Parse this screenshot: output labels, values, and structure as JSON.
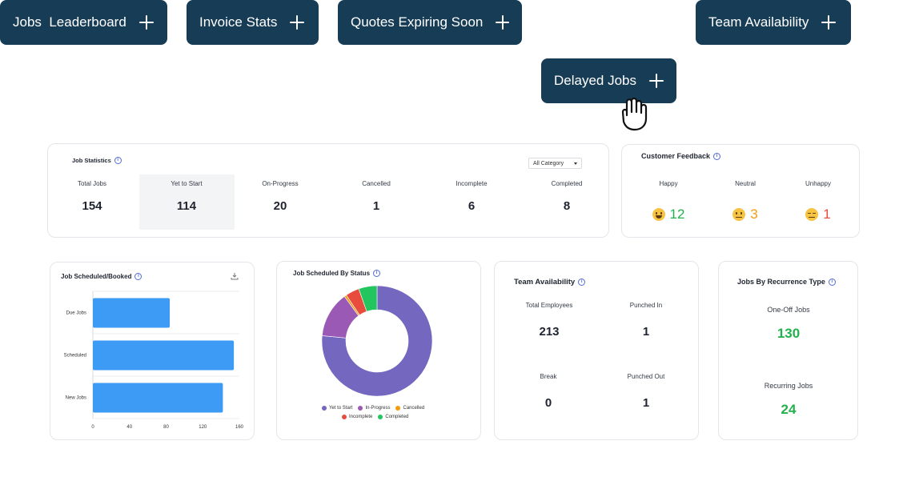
{
  "top_buttons": [
    {
      "label": "Jobs  Leaderboard"
    },
    {
      "label": "Invoice Stats"
    },
    {
      "label": "Quotes Expiring Soon"
    },
    {
      "label": "Team Availability"
    },
    {
      "label": "Delayed Jobs"
    }
  ],
  "job_statistics": {
    "title": "Job Statistics",
    "dropdown": "All Category",
    "items": [
      {
        "label": "Total Jobs",
        "value": "154"
      },
      {
        "label": "Yet to Start",
        "value": "114"
      },
      {
        "label": "On-Progress",
        "value": "20"
      },
      {
        "label": "Cancelled",
        "value": "1"
      },
      {
        "label": "Incomplete",
        "value": "6"
      },
      {
        "label": "Completed",
        "value": "8"
      }
    ]
  },
  "customer_feedback": {
    "title": "Customer Feedback",
    "items": [
      {
        "label": "Happy",
        "value": "12",
        "color": "#22b14c"
      },
      {
        "label": "Neutral",
        "value": "3",
        "color": "#f39c12"
      },
      {
        "label": "Unhappy",
        "value": "1",
        "color": "#e74c3c"
      }
    ]
  },
  "job_scheduled_booked": {
    "title": "Job Scheduled/Booked",
    "chart_data": {
      "type": "bar",
      "orientation": "horizontal",
      "categories": [
        "Due Jobs",
        "Scheduled",
        "New Jobs"
      ],
      "values": [
        84,
        154,
        142
      ],
      "xticks": [
        "0",
        "40",
        "80",
        "120",
        "160"
      ],
      "xlim": [
        0,
        160
      ],
      "color": "#3d9af5"
    }
  },
  "job_scheduled_by_status": {
    "title": "Job Scheduled By Status",
    "chart_data": {
      "type": "pie",
      "donut": true,
      "labels": [
        "Yet to Start",
        "In-Progress",
        "Cancelled",
        "Incomplete",
        "Completed"
      ],
      "values": [
        114,
        20,
        1,
        6,
        8
      ],
      "colors": [
        "#7367c0",
        "#9b59b6",
        "#f39c12",
        "#e74c3c",
        "#22c55e"
      ]
    }
  },
  "team_availability": {
    "title": "Team Availability",
    "items": [
      {
        "label": "Total Employees",
        "value": "213"
      },
      {
        "label": "Punched In",
        "value": "1"
      },
      {
        "label": "Break",
        "value": "0"
      },
      {
        "label": "Punched Out",
        "value": "1"
      }
    ]
  },
  "jobs_by_recurrence": {
    "title": "Jobs By Recurrence Type",
    "items": [
      {
        "label": "One-Off Jobs",
        "value": "130"
      },
      {
        "label": "Recurring Jobs",
        "value": "24"
      }
    ]
  }
}
